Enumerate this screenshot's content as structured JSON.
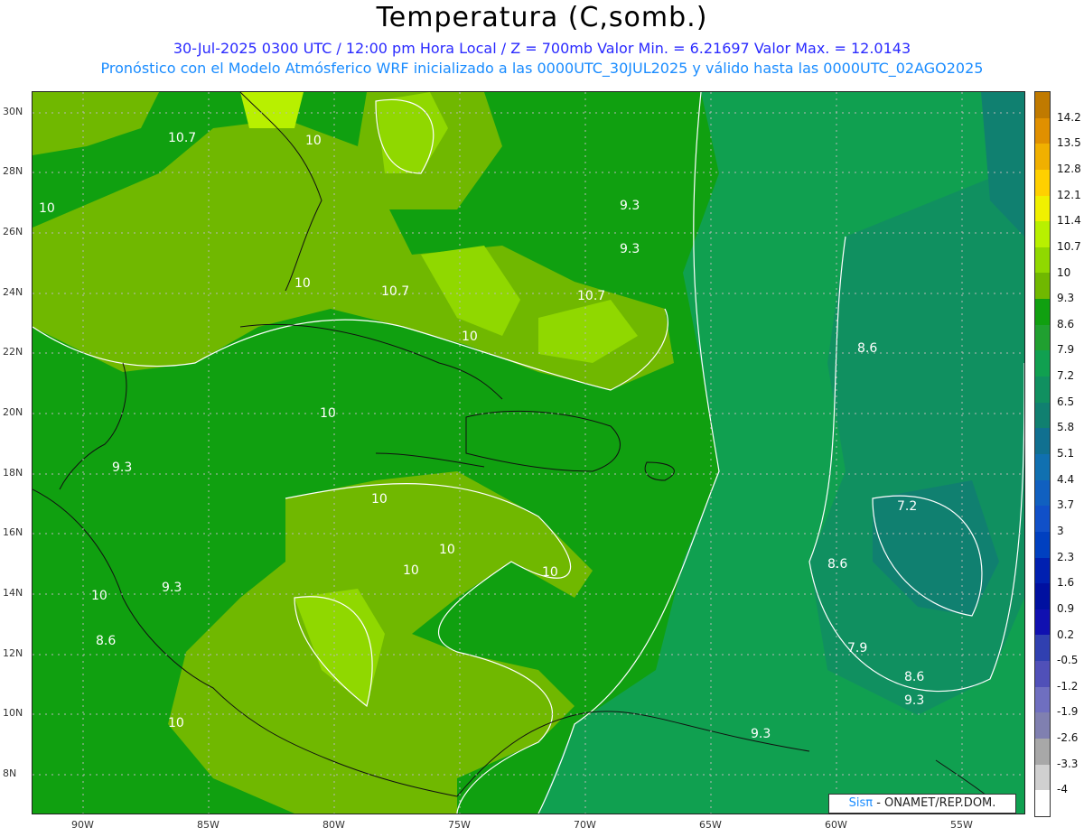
{
  "header": {
    "title": "Temperatura (C,somb.)",
    "line1": "30-Jul-2025  0300 UTC / 12:00 pm Hora Local / Z = 700mb   Valor Min. = 6.21697  Valor Max. = 12.0143",
    "line2": "Pronóstico con el Modelo Atmósferico WRF inicializado a las 0000UTC_30JUL2025 y válido hasta las  0000UTC_02AGO2025"
  },
  "axes": {
    "lon_labels": [
      "90W",
      "85W",
      "80W",
      "75W",
      "70W",
      "65W",
      "60W",
      "55W"
    ],
    "lat_labels": [
      "30N",
      "28N",
      "26N",
      "24N",
      "22N",
      "20N",
      "18N",
      "16N",
      "14N",
      "12N",
      "10N",
      "8N"
    ]
  },
  "contour_labels": [
    "10.7",
    "10",
    "10",
    "9.3",
    "9.3",
    "10",
    "10.7",
    "10.7",
    "10",
    "8.6",
    "10",
    "9.3",
    "10",
    "7.2",
    "10",
    "10",
    "8.6",
    "9.3",
    "10",
    "8.6",
    "10",
    "7.9",
    "8.6",
    "9.3",
    "10",
    "9.3"
  ],
  "colorbar": {
    "labels": [
      "14.2",
      "13.5",
      "12.8",
      "12.1",
      "11.4",
      "10.7",
      "10",
      "9.3",
      "8.6",
      "7.9",
      "7.2",
      "6.5",
      "5.8",
      "5.1",
      "4.4",
      "3.7",
      "3",
      "2.3",
      "1.6",
      "0.9",
      "0.2",
      "-0.5",
      "-1.2",
      "-1.9",
      "-2.6",
      "-3.3",
      "-4"
    ],
    "colors": [
      "#c07a00",
      "#e09000",
      "#f0b000",
      "#ffd000",
      "#f0f000",
      "#b8f000",
      "#90d800",
      "#70b800",
      "#10a010",
      "#20a030",
      "#10a050",
      "#109060",
      "#108070",
      "#107090",
      "#1070b0",
      "#1060c0",
      "#1050c8",
      "#0040c0",
      "#0020b0",
      "#0010a0",
      "#1010b0",
      "#3040b0",
      "#5050b8",
      "#6f6fc0",
      "#8080b0",
      "#a8a8a8",
      "#d0d0d0",
      "#ffffff"
    ]
  },
  "credit": {
    "brand": "Sisπ",
    "text": "- ONAMET/REP.DOM."
  },
  "colors": {
    "ocean_base": "#10a010",
    "warm_zone": "#70b800",
    "warmer_zone": "#90d800",
    "cool_zone": "#109060",
    "coolest_zone": "#108070"
  }
}
